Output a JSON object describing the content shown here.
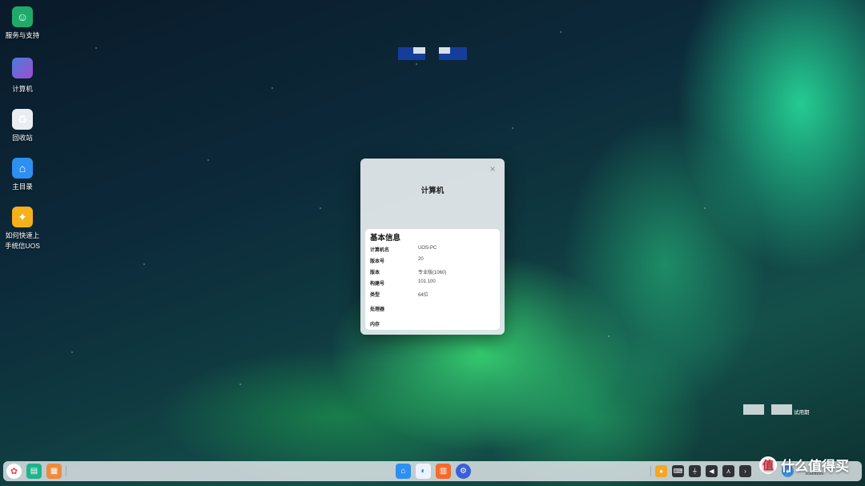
{
  "desktop": {
    "icons": [
      {
        "label": "服务与支持"
      },
      {
        "label": "计算机"
      },
      {
        "label": "回收站"
      },
      {
        "label": "主目录"
      },
      {
        "label": "如何快速上\n手统信UOS"
      }
    ]
  },
  "dialog": {
    "title": "计算机",
    "close": "×",
    "section_title": "基本信息",
    "rows": [
      {
        "key": "计算机名",
        "value": "UOS-PC"
      },
      {
        "key": "版本号",
        "value": "20"
      },
      {
        "key": "版本",
        "value": "专业版(1060)"
      },
      {
        "key": "构建号",
        "value": "101.100"
      },
      {
        "key": "类型",
        "value": "64位"
      },
      {
        "key": "处理器",
        "value": ""
      },
      {
        "key": "内存",
        "value": ""
      }
    ]
  },
  "watermark": {
    "text": "试用期"
  },
  "taskbar": {
    "clock": "2024/01/29"
  },
  "brand": {
    "badge": "值",
    "text": "什么值得买"
  },
  "colors": {
    "accent": "#153d9a",
    "aurora": "#2ee8a0"
  }
}
